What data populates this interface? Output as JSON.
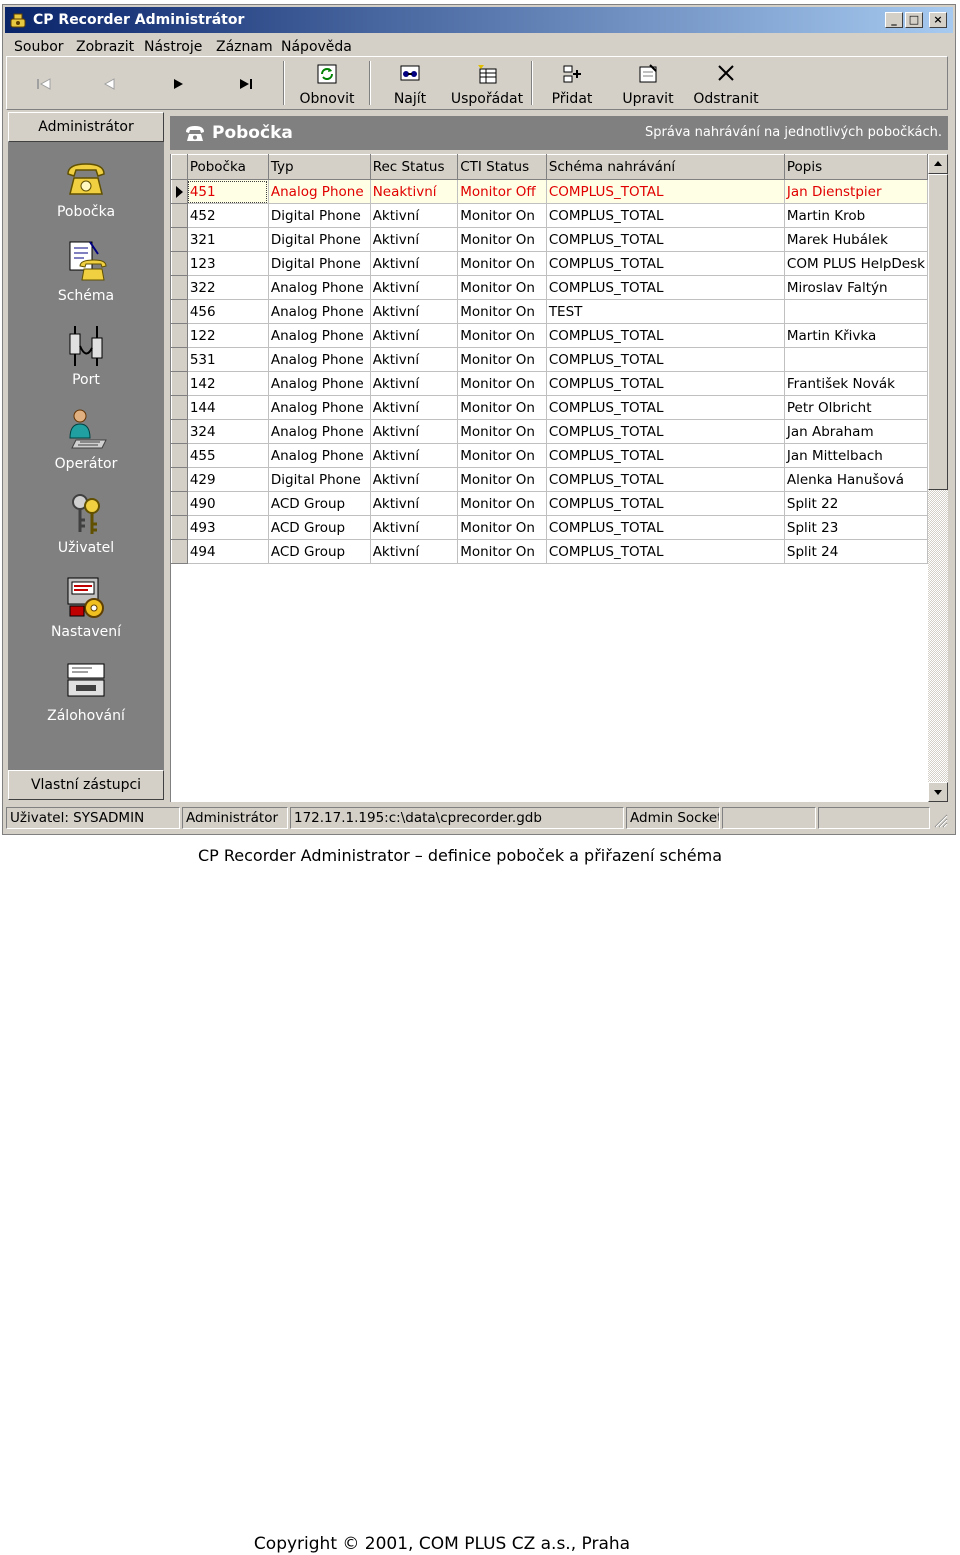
{
  "window": {
    "title": "CP Recorder Administrátor",
    "controls": [
      "_",
      "□",
      "×"
    ]
  },
  "menu": [
    "Soubor",
    "Zobrazit",
    "Nástroje",
    "Záznam",
    "Nápověda"
  ],
  "toolbar": {
    "nav": [
      "first-icon",
      "prev-icon",
      "next-icon",
      "last-icon"
    ],
    "buttons": [
      {
        "label": "Obnovit",
        "icon": "refresh-icon"
      },
      {
        "label": "Najít",
        "icon": "find-icon"
      },
      {
        "label": "Uspořádat",
        "icon": "sort-icon"
      },
      {
        "label": "Přidat",
        "icon": "add-icon"
      },
      {
        "label": "Upravit",
        "icon": "edit-icon"
      },
      {
        "label": "Odstranit",
        "icon": "delete-icon"
      }
    ]
  },
  "sidebar": {
    "header": "Administrátor",
    "footer": "Vlastní zástupci",
    "items": [
      {
        "label": "Pobočka",
        "icon": "phone-icon"
      },
      {
        "label": "Schéma",
        "icon": "schema-icon"
      },
      {
        "label": "Port",
        "icon": "port-icon"
      },
      {
        "label": "Operátor",
        "icon": "operator-icon"
      },
      {
        "label": "Uživatel",
        "icon": "keys-icon"
      },
      {
        "label": "Nastavení",
        "icon": "settings-icon"
      },
      {
        "label": "Zálohování",
        "icon": "backup-icon"
      }
    ]
  },
  "panel": {
    "title": "Pobočka",
    "subtitle": "Správa nahrávání na jednotlivých pobočkách."
  },
  "table": {
    "columns": [
      "Pobočka",
      "Typ",
      "Rec Status",
      "CTI Status",
      "Schéma nahrávání",
      "Popis"
    ],
    "rows": [
      [
        "451",
        "Analog Phone",
        "Neaktivní",
        "Monitor Off",
        "COMPLUS_TOTAL",
        "Jan Dienstpier"
      ],
      [
        "452",
        "Digital Phone",
        "Aktivní",
        "Monitor On",
        "COMPLUS_TOTAL",
        "Martin Krob"
      ],
      [
        "321",
        "Digital Phone",
        "Aktivní",
        "Monitor On",
        "COMPLUS_TOTAL",
        "Marek Hubálek"
      ],
      [
        "123",
        "Digital Phone",
        "Aktivní",
        "Monitor On",
        "COMPLUS_TOTAL",
        "COM PLUS HelpDesk"
      ],
      [
        "322",
        "Analog Phone",
        "Aktivní",
        "Monitor On",
        "COMPLUS_TOTAL",
        "Miroslav Faltýn"
      ],
      [
        "456",
        "Analog Phone",
        "Aktivní",
        "Monitor On",
        "TEST",
        ""
      ],
      [
        "122",
        "Analog Phone",
        "Aktivní",
        "Monitor On",
        "COMPLUS_TOTAL",
        "Martin Křivka"
      ],
      [
        "531",
        "Analog Phone",
        "Aktivní",
        "Monitor On",
        "COMPLUS_TOTAL",
        ""
      ],
      [
        "142",
        "Analog Phone",
        "Aktivní",
        "Monitor On",
        "COMPLUS_TOTAL",
        "František Novák"
      ],
      [
        "144",
        "Analog Phone",
        "Aktivní",
        "Monitor On",
        "COMPLUS_TOTAL",
        "Petr Olbricht"
      ],
      [
        "324",
        "Analog Phone",
        "Aktivní",
        "Monitor On",
        "COMPLUS_TOTAL",
        "Jan Abraham"
      ],
      [
        "455",
        "Analog Phone",
        "Aktivní",
        "Monitor On",
        "COMPLUS_TOTAL",
        "Jan Mittelbach"
      ],
      [
        "429",
        "Digital Phone",
        "Aktivní",
        "Monitor On",
        "COMPLUS_TOTAL",
        "Alenka Hanušová"
      ],
      [
        "490",
        "ACD Group",
        "Aktivní",
        "Monitor On",
        "COMPLUS_TOTAL",
        "Split 22"
      ],
      [
        "493",
        "ACD Group",
        "Aktivní",
        "Monitor On",
        "COMPLUS_TOTAL",
        "Split 23"
      ],
      [
        "494",
        "ACD Group",
        "Aktivní",
        "Monitor On",
        "COMPLUS_TOTAL",
        "Split 24"
      ]
    ],
    "selected_row": 0
  },
  "status": {
    "user": "Uživatel: SYSADMIN",
    "role": "Administrátor",
    "database": "172.17.1.195:c:\\data\\cprecorder.gdb",
    "socket": "Admin Socket"
  },
  "caption": "CP Recorder Administrator – definice poboček a přiřazení schéma",
  "copyright": "Copyright © 2001, COM PLUS CZ a.s., Praha"
}
